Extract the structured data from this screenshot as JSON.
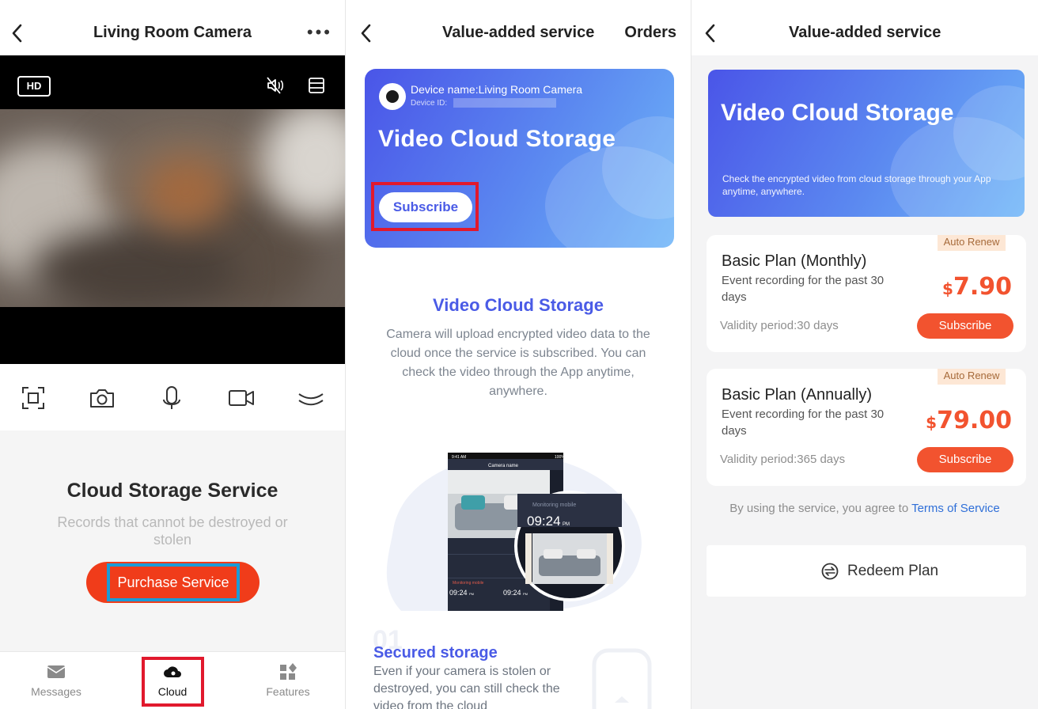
{
  "panel1": {
    "title": "Living Room Camera",
    "more": "•••",
    "hd_badge": "HD",
    "cloud_section": {
      "title": "Cloud Storage Service",
      "subtitle": "Records that cannot be destroyed or stolen",
      "button": "Purchase Service"
    },
    "tabs": [
      {
        "label": "Messages",
        "icon": "envelope-icon"
      },
      {
        "label": "Cloud",
        "icon": "cloud-icon"
      },
      {
        "label": "Features",
        "icon": "grid-icon"
      }
    ],
    "controls": [
      "fullscreen-icon",
      "camera-icon",
      "microphone-icon",
      "video-record-icon",
      "more-controls-icon"
    ]
  },
  "panel2": {
    "title": "Value-added service",
    "orders": "Orders",
    "device_name": "Device name:Living Room Camera",
    "device_id_label": "Device ID:",
    "hero_title": "Video Cloud Storage",
    "subscribe": "Subscribe",
    "section_title": "Video Cloud Storage",
    "section_desc": "Camera will upload encrypted video data to the cloud once the service is subscribed. You can check the video through the App anytime, anywhere.",
    "illustration": {
      "status_time": "9:41 AM",
      "battery": "100%",
      "screen_title": "Camera name",
      "monitoring_label": "Monitoring mobile",
      "clock_big": "09:24",
      "clock_big_ampm": "PM",
      "clock_small": "09:24",
      "clock_small_ampm": "PM"
    },
    "feature": {
      "number": "01",
      "title": "Secured storage",
      "desc": "Even if your camera is stolen or destroyed, you can still check the video from the cloud"
    }
  },
  "panel3": {
    "title": "Value-added service",
    "hero_title": "Video Cloud Storage",
    "hero_desc": "Check the encrypted video from cloud storage through your App anytime, anywhere.",
    "plans": [
      {
        "badge": "Auto Renew",
        "name": "Basic Plan (Monthly)",
        "desc": "Event recording for the past 30 days",
        "currency": "$",
        "price": "7.90",
        "validity": "Validity period:30 days",
        "button": "Subscribe"
      },
      {
        "badge": "Auto Renew",
        "name": "Basic Plan (Annually)",
        "desc": "Event recording for the past 30 days",
        "currency": "$",
        "price": "79.00",
        "validity": "Validity period:365 days",
        "button": "Subscribe"
      }
    ],
    "terms_prefix": "By using the service, you agree to ",
    "terms_link": "Terms of Service",
    "redeem": "Redeem Plan"
  },
  "colors": {
    "brand_blue": "#4a5be6",
    "accent_orange": "#f2532f",
    "purchase_red": "#f03c1a",
    "highlight_red": "#e1192d",
    "highlight_blue": "#1a9bd7"
  }
}
